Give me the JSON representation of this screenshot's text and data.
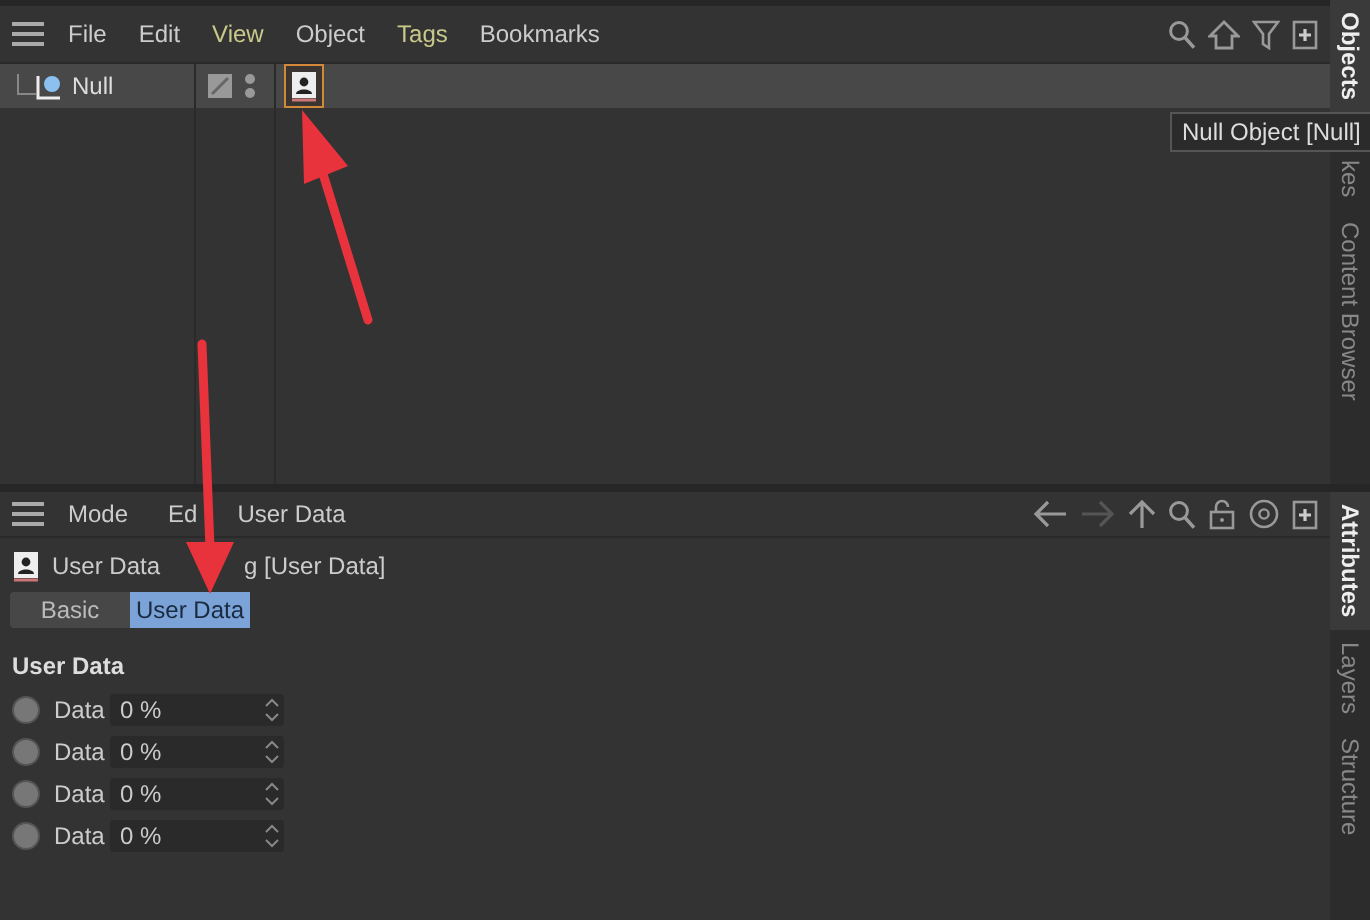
{
  "object_manager": {
    "menu": [
      {
        "label": "File",
        "highlighted": false
      },
      {
        "label": "Edit",
        "highlighted": false
      },
      {
        "label": "View",
        "highlighted": true
      },
      {
        "label": "Object",
        "highlighted": false
      },
      {
        "label": "Tags",
        "highlighted": true
      },
      {
        "label": "Bookmarks",
        "highlighted": false
      }
    ],
    "objects": [
      {
        "name": "Null",
        "tags": [
          {
            "kind": "user-data",
            "selected": true
          }
        ]
      }
    ],
    "tooltip": "Null Object [Null]"
  },
  "top_side_tabs": [
    {
      "label": "Objects",
      "selected": true
    },
    {
      "label": "kes",
      "selected": false
    },
    {
      "label": "Content Browser",
      "selected": false
    }
  ],
  "attribute_manager": {
    "menu": [
      "Mode",
      "Ed",
      "User Data"
    ],
    "title_parts": [
      "User Data",
      "g [User Data]"
    ],
    "tabs": [
      {
        "label": "Basic",
        "selected": false
      },
      {
        "label": "User Data",
        "selected": true
      }
    ],
    "group": "User Data",
    "fields": [
      {
        "label": "Data",
        "value": "0 %"
      },
      {
        "label": "Data",
        "value": "0 %"
      },
      {
        "label": "Data",
        "value": "0 %"
      },
      {
        "label": "Data",
        "value": "0 %"
      }
    ]
  },
  "bottom_side_tabs": [
    {
      "label": "Attributes",
      "selected": true
    },
    {
      "label": "Layers",
      "selected": false
    },
    {
      "label": "Structure",
      "selected": false
    }
  ]
}
